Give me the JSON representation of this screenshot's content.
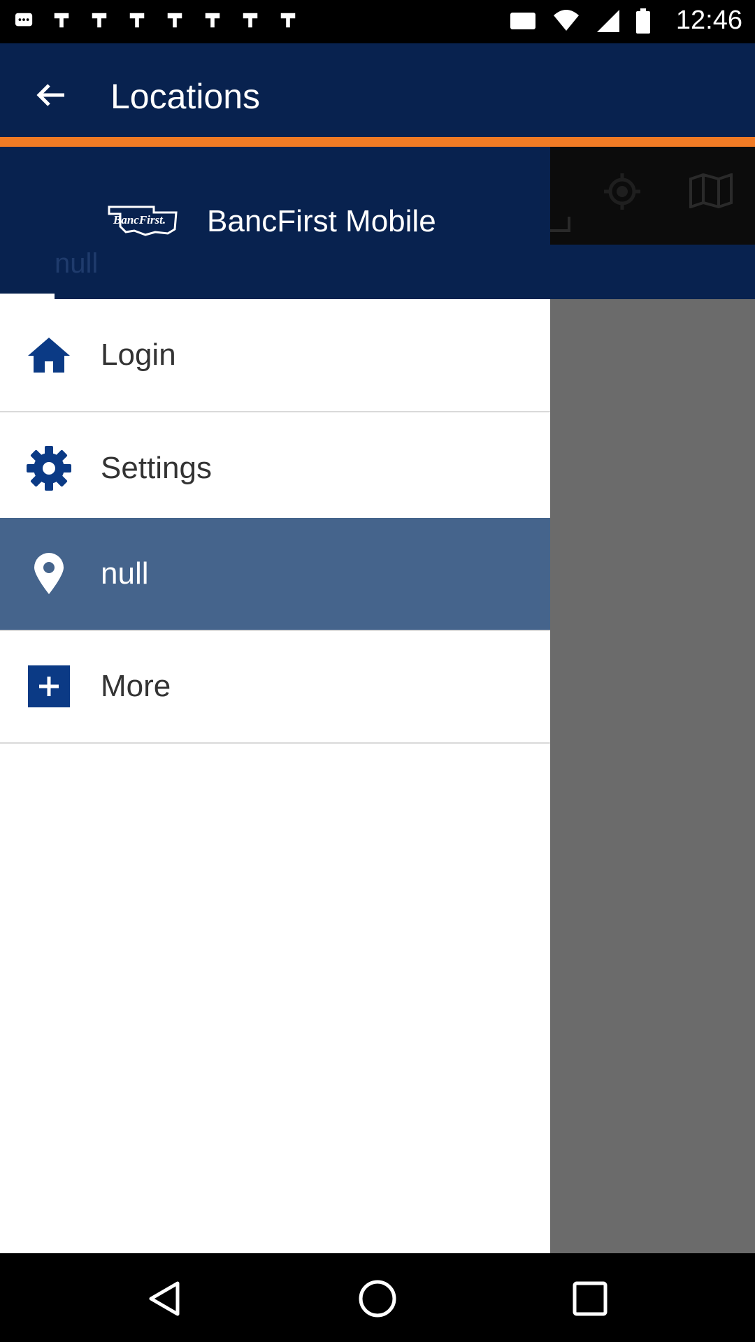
{
  "status_bar": {
    "time": "12:46"
  },
  "app_bar": {
    "title": "Locations"
  },
  "drawer": {
    "brand_logo_text": "BancFirst.",
    "brand_name": "BancFirst Mobile",
    "subtitle": "null",
    "items": [
      {
        "label": "Login",
        "icon": "home-icon"
      },
      {
        "label": "Settings",
        "icon": "gear-icon"
      },
      {
        "label": "null",
        "icon": "location-pin-icon",
        "active": true
      },
      {
        "label": "More",
        "icon": "plus-box-icon"
      }
    ]
  },
  "colors": {
    "primary": "#08224f",
    "accent": "#f07b25",
    "active_item": "#45648c",
    "icon_blue": "#0b3a85",
    "scrim": "#6b6b6b"
  }
}
